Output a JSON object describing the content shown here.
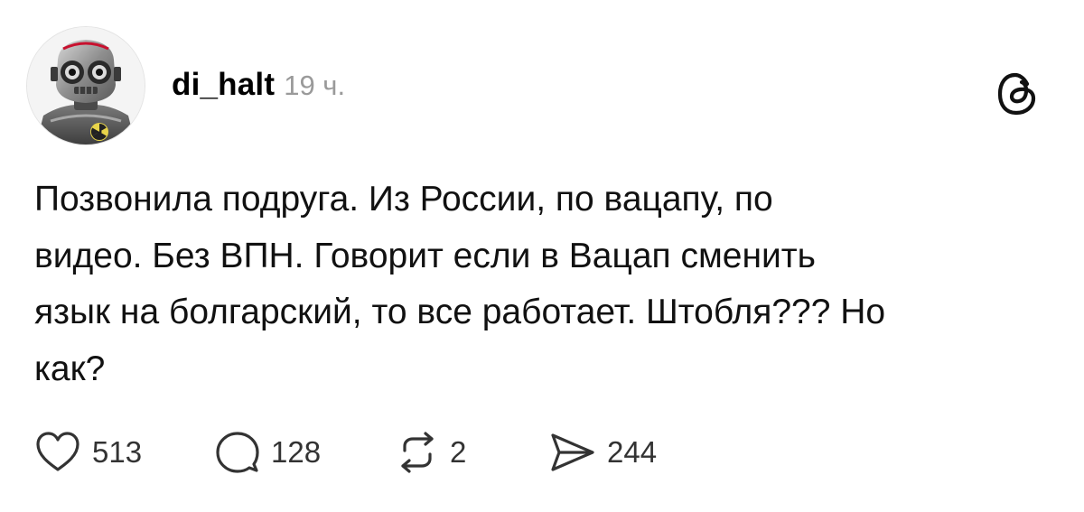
{
  "post": {
    "username": "di_halt",
    "timestamp": "19 ч.",
    "text": "Позвонила подруга. Из России, по вацапу, по\nвидео. Без ВПН. Говорит если в Вацап сменить\nязык на болгарский, то все работает. Штобля??? Но\nкак?",
    "actions": {
      "likes": "513",
      "replies": "128",
      "reposts": "2",
      "shares": "244"
    }
  },
  "icons": {
    "avatar": "robot-avatar",
    "logo": "threads-logo-icon",
    "like": "heart-icon",
    "reply": "comment-bubble-icon",
    "repost": "repost-arrows-icon",
    "share": "send-icon"
  },
  "colors": {
    "text": "#111111",
    "timestamp": "#9a9a9a",
    "icon": "#333333",
    "background": "#ffffff"
  }
}
